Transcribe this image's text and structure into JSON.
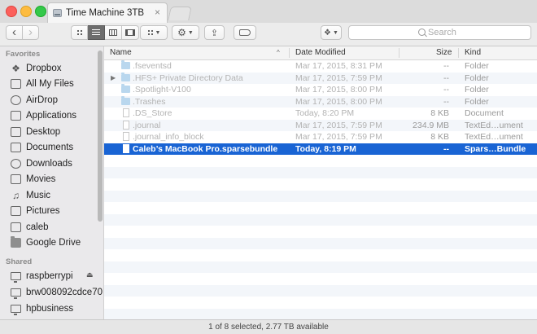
{
  "window": {
    "tab_title": "Time Machine 3TB",
    "tab_close": "×"
  },
  "toolbar": {
    "back": "‹",
    "forward": "›",
    "search_placeholder": "Search"
  },
  "sidebar": {
    "favorites_title": "Favorites",
    "shared_title": "Shared",
    "favorites": [
      {
        "label": "Dropbox",
        "icon": "dropbox-icon"
      },
      {
        "label": "All My Files",
        "icon": "all-files-icon"
      },
      {
        "label": "AirDrop",
        "icon": "airdrop-icon"
      },
      {
        "label": "Applications",
        "icon": "applications-icon"
      },
      {
        "label": "Desktop",
        "icon": "desktop-icon"
      },
      {
        "label": "Documents",
        "icon": "documents-icon"
      },
      {
        "label": "Downloads",
        "icon": "downloads-icon"
      },
      {
        "label": "Movies",
        "icon": "movies-icon"
      },
      {
        "label": "Music",
        "icon": "music-icon"
      },
      {
        "label": "Pictures",
        "icon": "pictures-icon"
      },
      {
        "label": "caleb",
        "icon": "home-icon"
      },
      {
        "label": "Google Drive",
        "icon": "folder-icon"
      }
    ],
    "shared": [
      {
        "label": "raspberrypi",
        "icon": "display-icon",
        "eject": "⏏"
      },
      {
        "label": "brw008092cdce70",
        "icon": "display-icon"
      },
      {
        "label": "hpbusiness",
        "icon": "display-icon"
      }
    ]
  },
  "columns": {
    "name": "Name",
    "date": "Date Modified",
    "size": "Size",
    "kind": "Kind"
  },
  "files": [
    {
      "name": ".fseventsd",
      "date": "Mar 17, 2015, 8:31 PM",
      "size": "--",
      "kind": "Folder",
      "type": "folder",
      "state": "hidden"
    },
    {
      "name": ".HFS+ Private Directory Data",
      "date": "Mar 17, 2015, 7:59 PM",
      "size": "--",
      "kind": "Folder",
      "type": "folder",
      "state": "hidden",
      "disclosure": "▶"
    },
    {
      "name": ".Spotlight-V100",
      "date": "Mar 17, 2015, 8:00 PM",
      "size": "--",
      "kind": "Folder",
      "type": "folder",
      "state": "hidden"
    },
    {
      "name": ".Trashes",
      "date": "Mar 17, 2015, 8:00 PM",
      "size": "--",
      "kind": "Folder",
      "type": "folder",
      "state": "hidden"
    },
    {
      "name": ".DS_Store",
      "date": "Today, 8:20 PM",
      "size": "8 KB",
      "kind": "Document",
      "type": "doc",
      "state": "hidden"
    },
    {
      "name": ".journal",
      "date": "Mar 17, 2015, 7:59 PM",
      "size": "234.9 MB",
      "kind": "TextEd…ument",
      "type": "doc",
      "state": "hidden"
    },
    {
      "name": ".journal_info_block",
      "date": "Mar 17, 2015, 7:59 PM",
      "size": "8 KB",
      "kind": "TextEd…ument",
      "type": "doc",
      "state": "hidden"
    },
    {
      "name": "Caleb’s MacBook Pro.sparsebundle",
      "date": "Today, 8:19 PM",
      "size": "--",
      "kind": "Spars…Bundle",
      "type": "sparse",
      "state": "selected"
    }
  ],
  "status": "1 of 8 selected, 2.77 TB available"
}
